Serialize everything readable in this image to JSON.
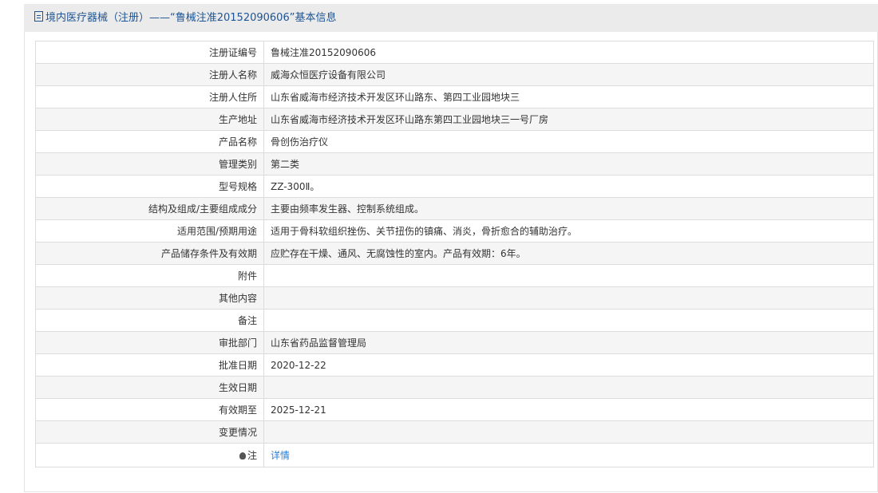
{
  "header": {
    "title": "境内医疗器械（注册）——“鲁械注准20152090606”基本信息"
  },
  "rows": [
    {
      "label": "注册证编号",
      "value": "鲁械注准20152090606"
    },
    {
      "label": "注册人名称",
      "value": "威海众恒医疗设备有限公司"
    },
    {
      "label": "注册人住所",
      "value": "山东省威海市经济技术开发区环山路东、第四工业园地块三"
    },
    {
      "label": "生产地址",
      "value": "山东省威海市经济技术开发区环山路东第四工业园地块三一号厂房"
    },
    {
      "label": "产品名称",
      "value": "骨创伤治疗仪"
    },
    {
      "label": "管理类别",
      "value": "第二类"
    },
    {
      "label": "型号规格",
      "value": "ZZ-300Ⅱ。"
    },
    {
      "label": "结构及组成/主要组成成分",
      "value": "主要由频率发生器、控制系统组成。"
    },
    {
      "label": "适用范围/预期用途",
      "value": "适用于骨科软组织挫伤、关节扭伤的镇痛、消炎，骨折愈合的辅助治疗。"
    },
    {
      "label": "产品储存条件及有效期",
      "value": "应贮存在干燥、通风、无腐蚀性的室内。产品有效期：6年。"
    },
    {
      "label": "附件",
      "value": ""
    },
    {
      "label": "其他内容",
      "value": ""
    },
    {
      "label": "备注",
      "value": ""
    },
    {
      "label": "审批部门",
      "value": "山东省药品监督管理局"
    },
    {
      "label": "批准日期",
      "value": "2020-12-22"
    },
    {
      "label": "生效日期",
      "value": ""
    },
    {
      "label": "有效期至",
      "value": "2025-12-21"
    },
    {
      "label": "变更情况",
      "value": ""
    }
  ],
  "note": {
    "label": "注",
    "link": "详情"
  }
}
